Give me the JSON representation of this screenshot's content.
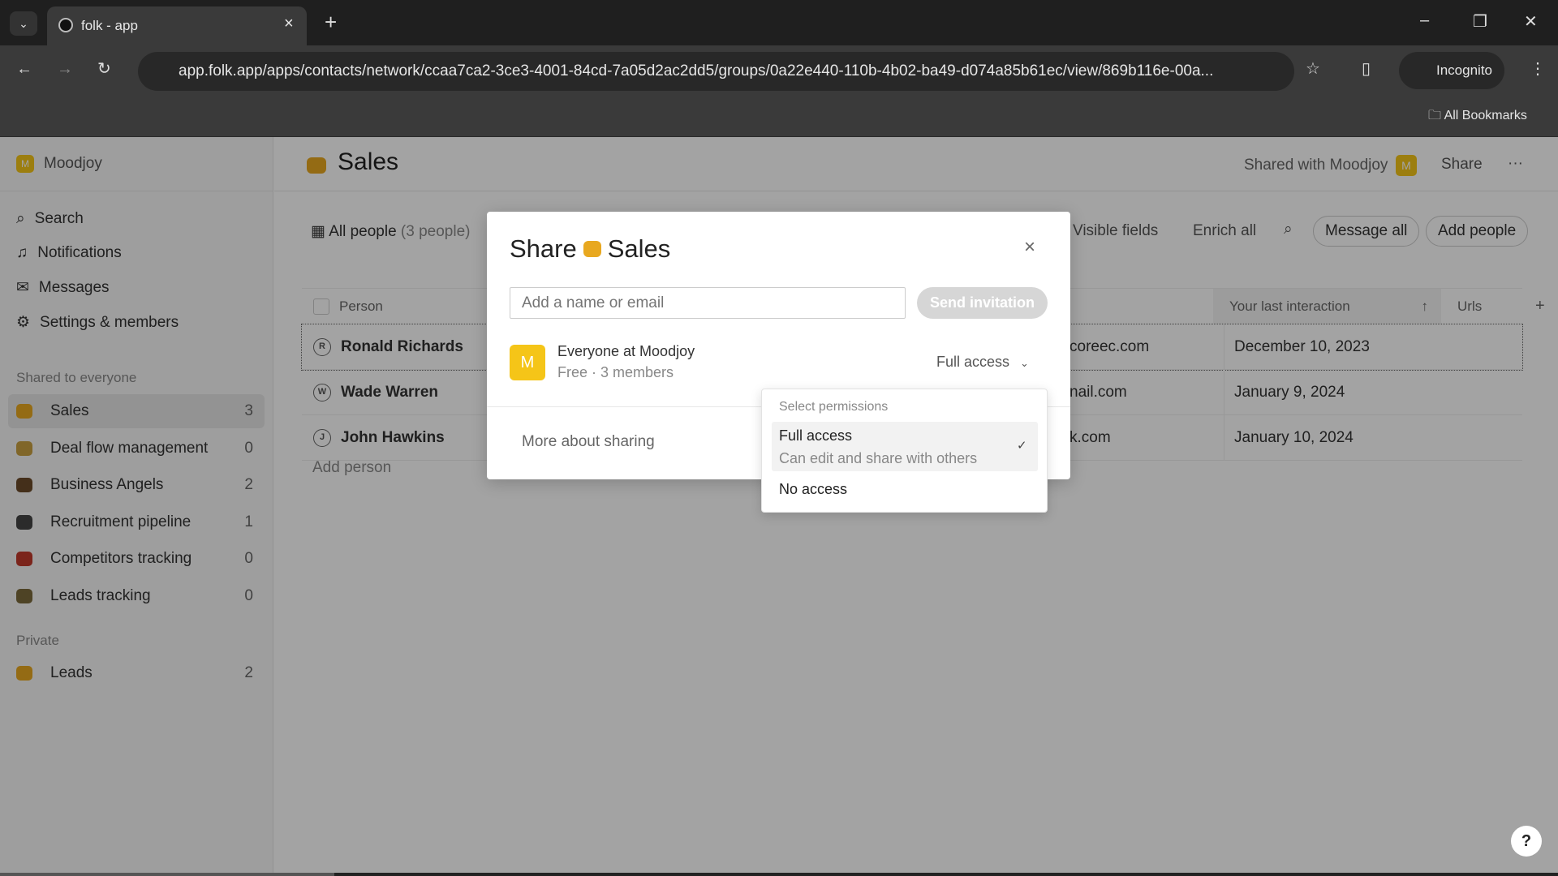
{
  "browser": {
    "tab_title": "folk - app",
    "url": "app.folk.app/apps/contacts/network/ccaa7ca2-3ce3-4001-84cd-7a05d2ac2dd5/groups/0a22e440-110b-4b02-ba49-d074a85b61ec/view/869b116e-00a...",
    "profile": "Incognito",
    "bookmarks": "All Bookmarks"
  },
  "sidebar": {
    "workspace": "Moodjoy",
    "workspace_initial": "M",
    "nav": [
      {
        "label": "Search",
        "icon": "search-icon"
      },
      {
        "label": "Notifications",
        "icon": "bell-icon"
      },
      {
        "label": "Messages",
        "icon": "mail-icon"
      },
      {
        "label": "Settings & members",
        "icon": "gear-icon"
      }
    ],
    "shared_heading": "Shared to everyone",
    "groups": [
      {
        "label": "Sales",
        "count": "3",
        "color": "#e8a820"
      },
      {
        "label": "Deal flow management",
        "count": "0",
        "color": "#c9a040"
      },
      {
        "label": "Business Angels",
        "count": "2",
        "color": "#6b4a2a"
      },
      {
        "label": "Recruitment pipeline",
        "count": "1",
        "color": "#444444"
      },
      {
        "label": "Competitors tracking",
        "count": "0",
        "color": "#c0392b"
      },
      {
        "label": "Leads tracking",
        "count": "0",
        "color": "#7a6a3a"
      }
    ],
    "private_heading": "Private",
    "private": [
      {
        "label": "Leads",
        "count": "2",
        "color": "#e8a820"
      }
    ]
  },
  "header": {
    "title": "Sales",
    "shared_with": "Shared with Moodjoy",
    "shared_initial": "M",
    "share": "Share",
    "more": "···"
  },
  "toolbar": {
    "view": "All people",
    "view_count": "(3 people)",
    "visible_fields": "Visible fields",
    "enrich_all": "Enrich all",
    "message_all": "Message all",
    "add_people": "Add people"
  },
  "table": {
    "columns": {
      "person": "Person",
      "last_interaction": "Your last interaction",
      "urls": "Urls",
      "add": "+"
    },
    "rows": [
      {
        "initial": "R",
        "name": "Ronald Richards",
        "email": "coreec.com",
        "last": "December 10, 2023"
      },
      {
        "initial": "W",
        "name": "Wade Warren",
        "email": "nail.com",
        "last": "January 9, 2024"
      },
      {
        "initial": "J",
        "name": "John Hawkins",
        "email": "k.com",
        "last": "January 10, 2024"
      }
    ],
    "add_person": "Add person"
  },
  "modal": {
    "title_prefix": "Share",
    "title_group": "Sales",
    "input_placeholder": "Add a name or email",
    "send": "Send invitation",
    "member": {
      "initial": "M",
      "name": "Everyone at Moodjoy",
      "sub": "Free · 3 members",
      "permission": "Full access"
    },
    "more": "More about sharing",
    "close": "×"
  },
  "dropdown": {
    "heading": "Select permissions",
    "options": [
      {
        "label": "Full access",
        "desc": "Can edit and share with others",
        "selected": true
      },
      {
        "label": "No access"
      }
    ]
  },
  "help": "?",
  "colors": {
    "accent": "#f5c518"
  }
}
